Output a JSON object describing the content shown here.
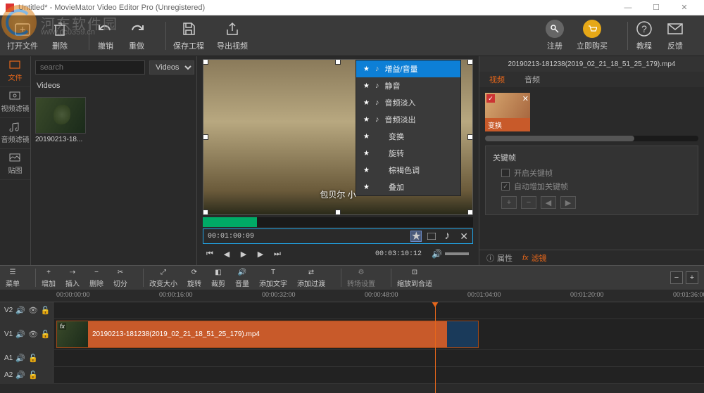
{
  "titlebar": {
    "title": "Untitled* - MovieMator Video Editor Pro (Unregistered)"
  },
  "watermark": {
    "text": "河东软件园",
    "url": "www.pc0359.cn"
  },
  "toolbar": {
    "open": "打开文件",
    "delete": "删除",
    "undo": "撤销",
    "redo": "重做",
    "save": "保存工程",
    "export": "导出视频",
    "register": "注册",
    "buy": "立即购买",
    "tutorial": "教程",
    "feedback": "反馈"
  },
  "left_tabs": {
    "file": "文件",
    "video_fx": "视频滤镜",
    "audio_fx": "音频滤镜",
    "sticker": "贴图"
  },
  "media": {
    "search_placeholder": "search",
    "category_select": "Videos",
    "category_label": "Videos",
    "items": [
      {
        "label": "20190213-18..."
      }
    ]
  },
  "context_menu": [
    {
      "label": "增益/音量",
      "icon": "note",
      "active": true
    },
    {
      "label": "静音",
      "icon": "note"
    },
    {
      "label": "音频淡入",
      "icon": "note"
    },
    {
      "label": "音频淡出",
      "icon": "note"
    },
    {
      "label": "变换",
      "icon": ""
    },
    {
      "label": "旋转",
      "icon": ""
    },
    {
      "label": "棕褐色调",
      "icon": ""
    },
    {
      "label": "叠加",
      "icon": ""
    }
  ],
  "preview": {
    "caption": "包贝尔   小",
    "scrub_time": "00:01:00:09",
    "total_time": "00:03:10:12"
  },
  "right_panel": {
    "filename": "20190213-181238(2019_02_21_18_51_25_179).mp4",
    "tabs": {
      "video": "视频",
      "audio": "音频"
    },
    "fx_chip": "变换",
    "keyframe_title": "关键帧",
    "enable_kf": "开启关键帧",
    "auto_kf": "自动增加关键帧",
    "footer_props": "属性",
    "footer_fx": "滤镜"
  },
  "timeline_toolbar": {
    "menu": "菜单",
    "append": "增加",
    "insert": "插入",
    "delete": "删除",
    "cut": "切分",
    "resize": "改变大小",
    "rotate": "旋转",
    "crop": "裁剪",
    "volume": "音量",
    "text": "添加文字",
    "trans": "添加过渡",
    "trans_set": "转场设置",
    "fit": "缩放到合适"
  },
  "timeline": {
    "ticks": [
      "00:00:00:00",
      "00:00:16:00",
      "00:00:32:00",
      "00:00:48:00",
      "00:01:04:00",
      "00:01:20:00",
      "00:01:36:00"
    ],
    "tracks": {
      "v2": "V2",
      "v1": "V1",
      "a1": "A1",
      "a2": "A2"
    },
    "clip_label": "20190213-181238(2019_02_21_18_51_25_179).mp4",
    "clip_fx": "fx"
  }
}
